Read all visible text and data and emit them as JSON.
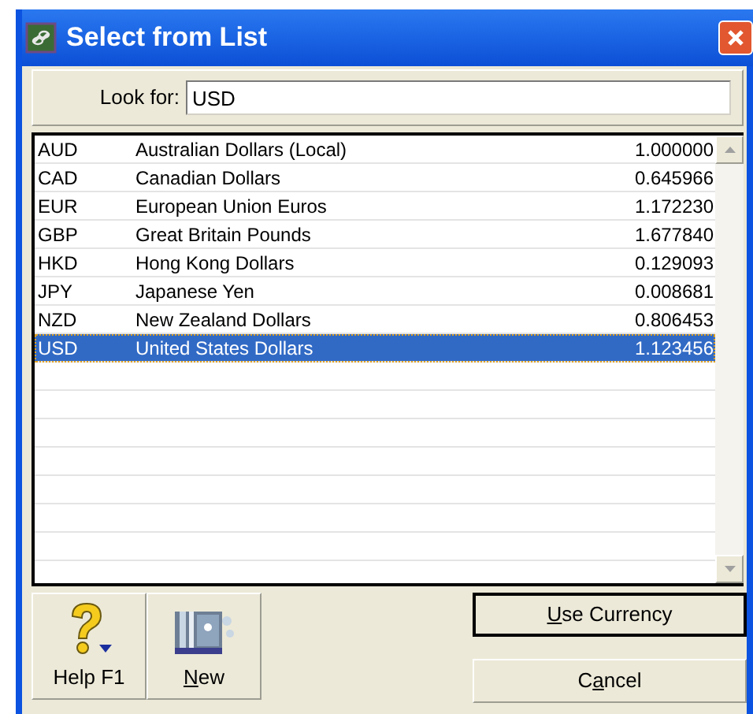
{
  "window": {
    "title": "Select from List"
  },
  "search": {
    "label": "Look for:",
    "value": "USD"
  },
  "rows": [
    {
      "code": "AUD",
      "name": "Australian Dollars (Local)",
      "rate": "1.000000",
      "selected": false
    },
    {
      "code": "CAD",
      "name": "Canadian Dollars",
      "rate": "0.645966",
      "selected": false
    },
    {
      "code": "EUR",
      "name": "European Union Euros",
      "rate": "1.172230",
      "selected": false
    },
    {
      "code": "GBP",
      "name": "Great Britain Pounds",
      "rate": "1.677840",
      "selected": false
    },
    {
      "code": "HKD",
      "name": "Hong Kong Dollars",
      "rate": "0.129093",
      "selected": false
    },
    {
      "code": "JPY",
      "name": "Japanese Yen",
      "rate": "0.008681",
      "selected": false
    },
    {
      "code": "NZD",
      "name": "New Zealand Dollars",
      "rate": "0.806453",
      "selected": false
    },
    {
      "code": "USD",
      "name": "United States Dollars",
      "rate": "1.123456",
      "selected": true
    }
  ],
  "toolbar": [
    {
      "kind": "help",
      "label_parts": [
        {
          "text": "Help F1",
          "underlined": false
        }
      ]
    },
    {
      "kind": "new",
      "label_parts": [
        {
          "text": "N",
          "underlined": true
        },
        {
          "text": "ew",
          "underlined": false
        }
      ]
    }
  ],
  "buttons": [
    {
      "label_parts": [
        {
          "text": "U",
          "underlined": true
        },
        {
          "text": "se Currency",
          "underlined": false
        }
      ],
      "default": true
    },
    {
      "label_parts": [
        {
          "text": "C",
          "underlined": false
        },
        {
          "text": "a",
          "underlined": true
        },
        {
          "text": "ncel",
          "underlined": false
        }
      ],
      "default": false
    }
  ]
}
